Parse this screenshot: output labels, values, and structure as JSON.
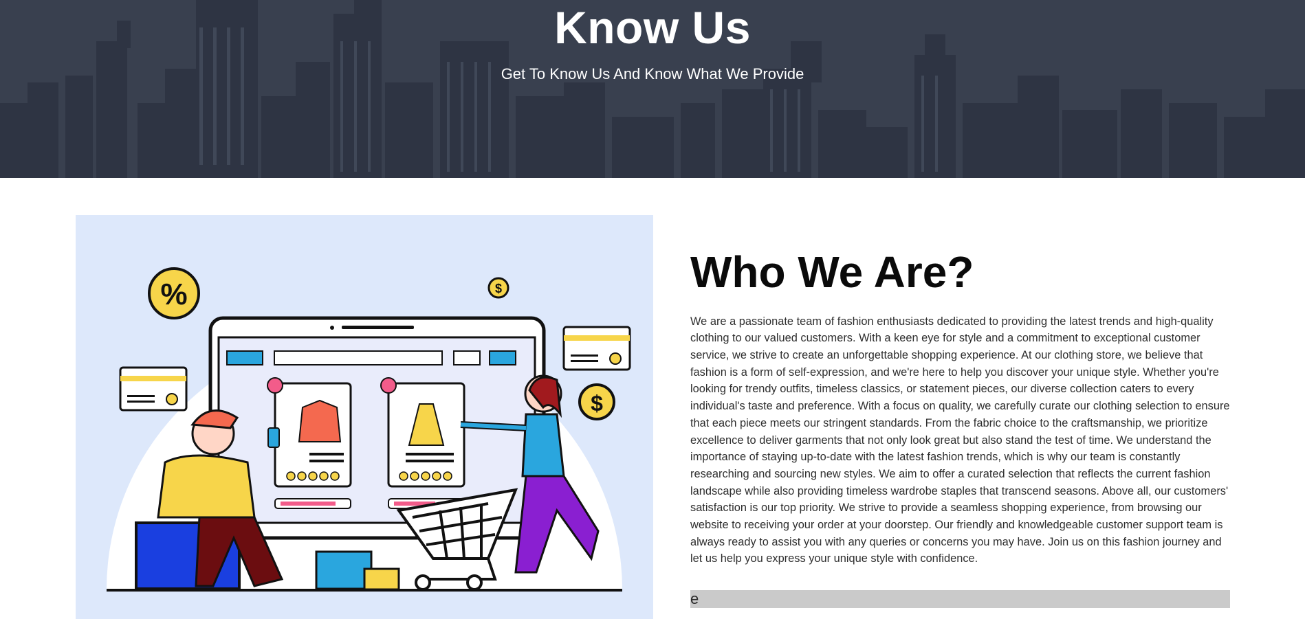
{
  "hero": {
    "title": "Know Us",
    "subtitle": "Get To Know Us And Know What We Provide"
  },
  "illustration": {
    "percent_badge": "%",
    "coin_symbol": "$"
  },
  "about": {
    "heading": "Who We Are?",
    "body": "We are a passionate team of fashion enthusiasts dedicated to providing the latest trends and high-quality clothing to our valued customers. With a keen eye for style and a commitment to exceptional customer service, we strive to create an unforgettable shopping experience. At our clothing store, we believe that fashion is a form of self-expression, and we're here to help you discover your unique style. Whether you're looking for trendy outfits, timeless classics, or statement pieces, our diverse collection caters to every individual's taste and preference. With a focus on quality, we carefully curate our clothing selection to ensure that each piece meets our stringent standards. From the fabric choice to the craftsmanship, we prioritize excellence to deliver garments that not only look great but also stand the test of time. We understand the importance of staying up-to-date with the latest fashion trends, which is why our team is constantly researching and sourcing new styles. We aim to offer a curated selection that reflects the current fashion landscape while also providing timeless wardrobe staples that transcend seasons. Above all, our customers' satisfaction is our top priority. We strive to provide a seamless shopping experience, from browsing our website to receiving your order at your doorstep. Our friendly and knowledgeable customer support team is always ready to assist you with any queries or concerns you may have. Join us on this fashion journey and let us help you express your unique style with confidence.",
    "truncated_bar_text": "e"
  },
  "colors": {
    "hero_bg": "#39404f",
    "illustration_bg": "#dde8fb",
    "accent_yellow": "#f7d54a",
    "accent_blue": "#2aa6de"
  }
}
